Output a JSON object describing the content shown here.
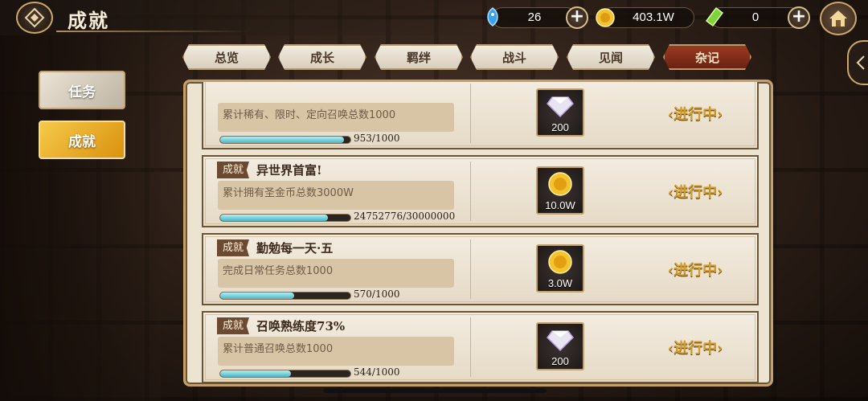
{
  "header": {
    "title": "成就",
    "currencies": [
      {
        "icon": "blue-fish-icon",
        "value": "26",
        "has_plus": true
      },
      {
        "icon": "gold-coin-icon",
        "value": "403.1W",
        "has_plus": false
      },
      {
        "icon": "green-crystal-icon",
        "value": "0",
        "has_plus": true
      }
    ]
  },
  "left_nav": [
    {
      "label": "任务",
      "active": false
    },
    {
      "label": "成就",
      "active": true
    }
  ],
  "tabs": [
    {
      "label": "总览",
      "active": false
    },
    {
      "label": "成长",
      "active": false
    },
    {
      "label": "羁绊",
      "active": false
    },
    {
      "label": "战斗",
      "active": false
    },
    {
      "label": "见闻",
      "active": false
    },
    {
      "label": "杂记",
      "active": true
    }
  ],
  "achievements": [
    {
      "badge": "",
      "title": "",
      "desc": "累计稀有、限时、定向召唤总数1000",
      "progress_text": "953/1000",
      "progress": 0.953,
      "reward_icon": "diamond-crystal-icon",
      "reward_qty": "200",
      "status": "进行中"
    },
    {
      "badge": "成就",
      "title": "异世界首富!",
      "desc": "累计拥有圣金币总数3000W",
      "progress_text": "24752776/30000000",
      "progress": 0.825,
      "reward_icon": "gold-coin-icon",
      "reward_qty": "10.0W",
      "status": "进行中"
    },
    {
      "badge": "成就",
      "title": "勤勉每一天·五",
      "desc": "完成日常任务总数1000",
      "progress_text": "570/1000",
      "progress": 0.57,
      "reward_icon": "gold-coin-icon",
      "reward_qty": "3.0W",
      "status": "进行中"
    },
    {
      "badge": "成就",
      "title": "召唤熟练度73%",
      "desc": "累计普通召唤总数1000",
      "progress_text": "544/1000",
      "progress": 0.544,
      "reward_icon": "diamond-crystal-icon",
      "reward_qty": "200",
      "status": "进行中"
    }
  ],
  "colors": {
    "accent_gold": "#d49d2a",
    "tab_active": "#7d2a18",
    "progress_fill": "#4fb4c4"
  }
}
